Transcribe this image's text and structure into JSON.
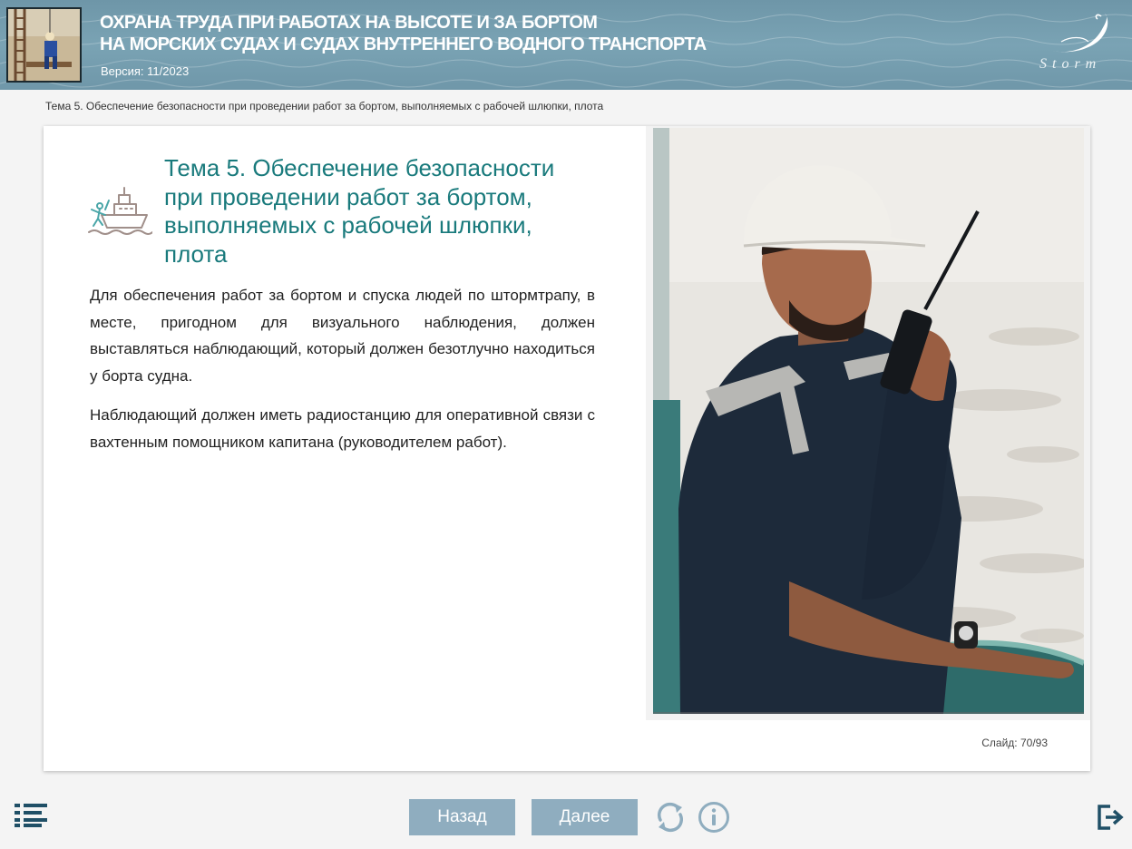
{
  "header": {
    "title_line1": "ОХРАНА ТРУДА ПРИ РАБОТАХ НА ВЫСОТЕ И ЗА БОРТОМ",
    "title_line2": "НА МОРСКИХ СУДАХ И СУДАХ ВНУТРЕННЕГО ВОДНОГО ТРАНСПОРТА",
    "version": "Версия: 11/2023",
    "logo_text": "Storm"
  },
  "breadcrumb": "Тема 5. Обеспечение безопасности при проведении работ за бортом, выполняемых с рабочей шлюпки, плота",
  "slide": {
    "title": "Тема 5. Обеспечение безопасности при проведении работ за бортом, выполняемых с рабочей шлюпки, плота",
    "paragraph1": "Для обеспечения работ за бортом и спуска людей по штормтрапу, в месте, пригодном для визуального наблюдения, должен выставляться наблюдающий, который должен безотлучно находиться у борта судна.",
    "paragraph2": "Наблюдающий должен иметь радиостанцию для оперативной связи с вахтенным помощником капитана (руководителем работ).",
    "counter_label": "Слайд:",
    "counter_value": "70/93"
  },
  "nav": {
    "back_label": "Назад",
    "next_label": "Далее",
    "icons": [
      "menu-icon",
      "reload-icon",
      "info-icon",
      "exit-icon"
    ]
  },
  "colors": {
    "header_bg": "#7aa3b4",
    "title_teal": "#197a7c",
    "button_bg": "#8fadbf",
    "nav_icon": "#1f4f66"
  }
}
